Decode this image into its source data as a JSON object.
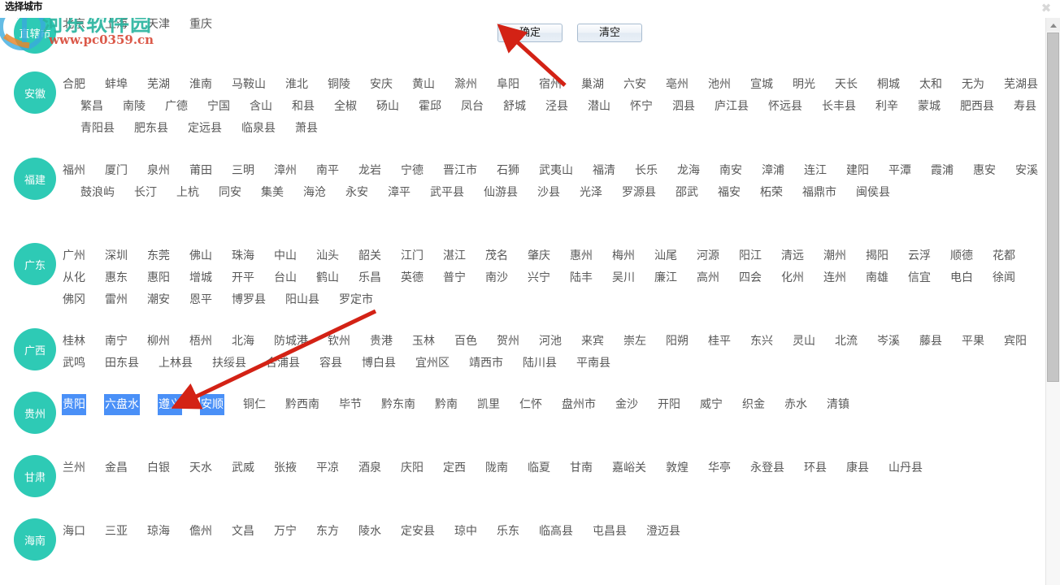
{
  "window": {
    "title": "选择城市",
    "close_icon": "close-icon"
  },
  "watermark": {
    "brand": "河东软件园",
    "url": "www.pc0359.cn",
    "brand_color": "#2bb5a0",
    "url_color": "#d94b3a"
  },
  "toolbar": {
    "confirm_label": "确定",
    "clear_label": "清空"
  },
  "colors": {
    "province_badge": "#2ecab5",
    "selected_city": "#f7b8c2",
    "text_selection": "#4a90f7",
    "city_text": "#585858"
  },
  "scrollbar": {
    "up_arrow_icon": "triangle-up-icon",
    "position": "top"
  },
  "provinces": [
    {
      "name": "直辖市",
      "cities": [
        "北京",
        "上海",
        "天津",
        "重庆"
      ],
      "states": [
        "normal",
        "normal",
        "normal",
        "normal"
      ]
    },
    {
      "name": "安徽",
      "cities": [
        "合肥",
        "蚌埠",
        "芜湖",
        "淮南",
        "马鞍山",
        "淮北",
        "铜陵",
        "安庆",
        "黄山",
        "滁州",
        "阜阳",
        "宿州",
        "巢湖",
        "六安",
        "亳州",
        "池州",
        "宣城",
        "明光",
        "天长",
        "桐城",
        "太和",
        "无为",
        "芜湖县",
        "繁昌",
        "南陵",
        "广德",
        "宁国",
        "含山",
        "和县",
        "全椒",
        "砀山",
        "霍邱",
        "凤台",
        "舒城",
        "泾县",
        "潜山",
        "怀宁",
        "泗县",
        "庐江县",
        "怀远县",
        "长丰县",
        "利辛",
        "蒙城",
        "肥西县",
        "寿县",
        "青阳县",
        "肥东县",
        "定远县",
        "临泉县",
        "萧县"
      ],
      "states": []
    },
    {
      "name": "福建",
      "cities": [
        "福州",
        "厦门",
        "泉州",
        "莆田",
        "三明",
        "漳州",
        "南平",
        "龙岩",
        "宁德",
        "晋江市",
        "石狮",
        "武夷山",
        "福清",
        "长乐",
        "龙海",
        "南安",
        "漳浦",
        "连江",
        "建阳",
        "平潭",
        "霞浦",
        "惠安",
        "安溪",
        "鼓浪屿",
        "长汀",
        "上杭",
        "同安",
        "集美",
        "海沧",
        "永安",
        "漳平",
        "武平县",
        "仙游县",
        "沙县",
        "光泽",
        "罗源县",
        "邵武",
        "福安",
        "柘荣",
        "福鼎市",
        "闽侯县"
      ],
      "states": []
    },
    {
      "name": "广东",
      "cities": [
        "广州",
        "深圳",
        "东莞",
        "佛山",
        "珠海",
        "中山",
        "汕头",
        "韶关",
        "江门",
        "湛江",
        "茂名",
        "肇庆",
        "惠州",
        "梅州",
        "汕尾",
        "河源",
        "阳江",
        "清远",
        "潮州",
        "揭阳",
        "云浮",
        "顺德",
        "花都",
        "从化",
        "惠东",
        "惠阳",
        "增城",
        "开平",
        "台山",
        "鹤山",
        "乐昌",
        "英德",
        "普宁",
        "南沙",
        "兴宁",
        "陆丰",
        "吴川",
        "廉江",
        "高州",
        "四会",
        "化州",
        "连州",
        "南雄",
        "信宜",
        "电白",
        "徐闻",
        "佛冈",
        "雷州",
        "潮安",
        "恩平",
        "博罗县",
        "阳山县",
        "罗定市"
      ],
      "states": []
    },
    {
      "name": "广西",
      "cities": [
        "桂林",
        "南宁",
        "柳州",
        "梧州",
        "北海",
        "防城港",
        "钦州",
        "贵港",
        "玉林",
        "百色",
        "贺州",
        "河池",
        "来宾",
        "崇左",
        "阳朔",
        "桂平",
        "东兴",
        "灵山",
        "北流",
        "岑溪",
        "藤县",
        "平果",
        "宾阳",
        "武鸣",
        "田东县",
        "上林县",
        "扶绥县",
        "合浦县",
        "容县",
        "博白县",
        "宜州区",
        "靖西市",
        "陆川县",
        "平南县"
      ],
      "states": []
    },
    {
      "name": "贵州",
      "cities": [
        "贵阳",
        "六盘水",
        "遵义",
        "安顺",
        "铜仁",
        "黔西南",
        "毕节",
        "黔东南",
        "黔南",
        "凯里",
        "仁怀",
        "盘州市",
        "金沙",
        "开阳",
        "威宁",
        "织金",
        "赤水",
        "清镇"
      ],
      "states": [
        "selected",
        "normal",
        "normal",
        "selected",
        "normal",
        "normal",
        "normal",
        "normal",
        "normal",
        "normal",
        "normal",
        "normal",
        "normal",
        "normal",
        "normal",
        "normal",
        "normal",
        "normal"
      ],
      "text_selection_range": [
        0,
        3
      ]
    },
    {
      "name": "甘肃",
      "cities": [
        "兰州",
        "金昌",
        "白银",
        "天水",
        "武威",
        "张掖",
        "平凉",
        "酒泉",
        "庆阳",
        "定西",
        "陇南",
        "临夏",
        "甘南",
        "嘉峪关",
        "敦煌",
        "华亭",
        "永登县",
        "环县",
        "康县",
        "山丹县"
      ],
      "states": []
    },
    {
      "name": "海南",
      "cities": [
        "海口",
        "三亚",
        "琼海",
        "儋州",
        "文昌",
        "万宁",
        "东方",
        "陵水",
        "定安县",
        "琼中",
        "乐东",
        "临高县",
        "屯昌县",
        "澄迈县"
      ],
      "states": []
    }
  ],
  "annotations": [
    {
      "name": "arrow-to-confirm-button",
      "color": "#d32215"
    },
    {
      "name": "arrow-to-guizhou-selection",
      "color": "#d32215"
    }
  ]
}
